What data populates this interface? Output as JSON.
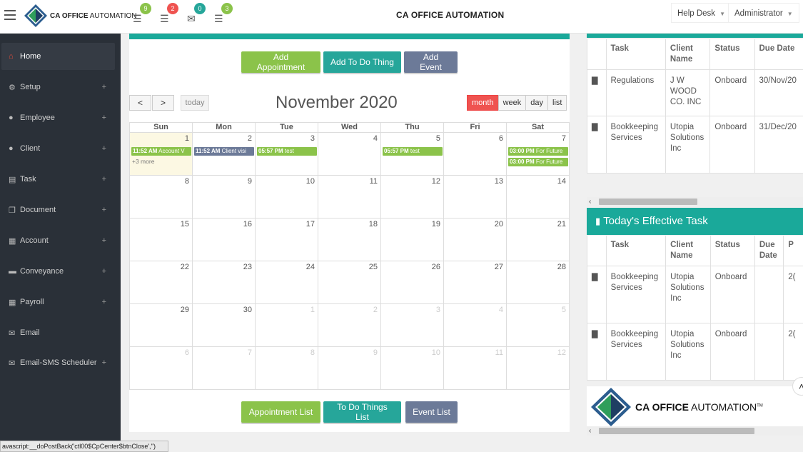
{
  "header": {
    "brand_bold": "CA OFFICE",
    "brand_rest": "AUTOMATION",
    "title": "CA OFFICE AUTOMATION",
    "help_desk": "Help Desk",
    "admin": "Administrator",
    "notifications": [
      {
        "icon": "list-icon",
        "count": "9",
        "color": "#8bc34a"
      },
      {
        "icon": "list-icon",
        "count": "2",
        "color": "#ef5350"
      },
      {
        "icon": "envelope-icon",
        "count": "0",
        "color": "#26a69a"
      },
      {
        "icon": "list-icon",
        "count": "3",
        "color": "#8bc34a"
      }
    ]
  },
  "sidebar": {
    "items": [
      {
        "label": "Home",
        "icon": "home-icon",
        "plus": ""
      },
      {
        "label": "Setup",
        "icon": "gear-icon",
        "plus": "+"
      },
      {
        "label": "Employee",
        "icon": "user-icon",
        "plus": "+"
      },
      {
        "label": "Client",
        "icon": "user-icon",
        "plus": "+"
      },
      {
        "label": "Task",
        "icon": "task-icon",
        "plus": "+"
      },
      {
        "label": "Document",
        "icon": "document-icon",
        "plus": "+"
      },
      {
        "label": "Account",
        "icon": "calculator-icon",
        "plus": "+"
      },
      {
        "label": "Conveyance",
        "icon": "car-icon",
        "plus": "+"
      },
      {
        "label": "Payroll",
        "icon": "calculator-icon",
        "plus": "+"
      },
      {
        "label": "Email",
        "icon": "envelope-icon",
        "plus": ""
      },
      {
        "label": "Email-SMS Scheduler",
        "icon": "envelope-icon",
        "plus": "+"
      }
    ]
  },
  "calendar": {
    "buttons": {
      "add_appointment": "Add Appointment",
      "add_todo": "Add To Do Thing",
      "add_event": "Add Event",
      "appointment_list": "Appointment List",
      "todo_list": "To Do Things List",
      "event_list": "Event List"
    },
    "prev": "<",
    "next": ">",
    "today": "today",
    "title": "November 2020",
    "views": [
      "month",
      "week",
      "day",
      "list"
    ],
    "days_of_week": [
      "Sun",
      "Mon",
      "Tue",
      "Wed",
      "Thu",
      "Fri",
      "Sat"
    ],
    "weeks": [
      [
        "1",
        "2",
        "3",
        "4",
        "5",
        "6",
        "7"
      ],
      [
        "8",
        "9",
        "10",
        "11",
        "12",
        "13",
        "14"
      ],
      [
        "15",
        "16",
        "17",
        "18",
        "19",
        "20",
        "21"
      ],
      [
        "22",
        "23",
        "24",
        "25",
        "26",
        "27",
        "28"
      ],
      [
        "29",
        "30",
        "1",
        "2",
        "3",
        "4",
        "5"
      ],
      [
        "6",
        "7",
        "8",
        "9",
        "10",
        "11",
        "12"
      ]
    ],
    "events": {
      "sun_time": "11:52 AM",
      "sun_text": "Account V",
      "sun_more": "+3 more",
      "mon_time": "11:52 AM",
      "mon_text": "Client visi",
      "tue_time": "05:57 PM",
      "tue_text": "test",
      "thu_time": "05:57 PM",
      "thu_text": "test",
      "sat1_time": "03:00 PM",
      "sat1_text": "For Future",
      "sat2_time": "03:00 PM",
      "sat2_text": "For Future"
    }
  },
  "table1": {
    "headers": [
      "Task",
      "Client Name",
      "Status",
      "Due Date"
    ],
    "rows": [
      {
        "task": "Regulations",
        "client": "J W WOOD CO. INC",
        "status": "Onboard",
        "due": "30/Nov/20"
      },
      {
        "task": "Bookkeeping Services",
        "client": "Utopia Solutions Inc",
        "status": "Onboard",
        "due": "31/Dec/20"
      }
    ]
  },
  "effective": {
    "title": "Today's Effective Task",
    "headers": [
      "Task",
      "Client Name",
      "Status",
      "Due Date",
      "P"
    ],
    "rows": [
      {
        "task": "Bookkeeping Services",
        "client": "Utopia Solutions Inc",
        "status": "Onboard",
        "due": "",
        "p": "2("
      },
      {
        "task": "Bookkeeping Services",
        "client": "Utopia Solutions Inc",
        "status": "Onboard",
        "due": "",
        "p": "2("
      }
    ]
  },
  "footer": {
    "brand_bold": "CA OFFICE",
    "brand_rest": "AUTOMATION",
    "tm": "TM"
  },
  "statusbar": "avascript:__doPostBack('ctl00$CpCenter$btnClose','')"
}
